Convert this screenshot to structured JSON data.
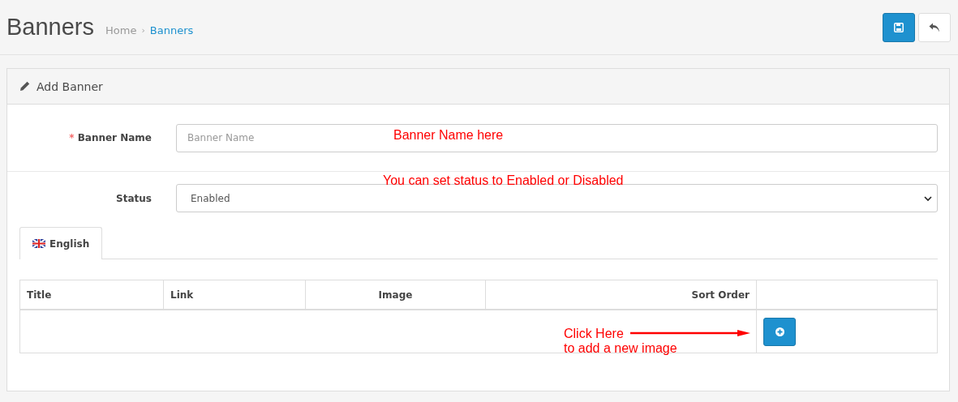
{
  "page_title": "Banners",
  "breadcrumb_separator": "›",
  "breadcrumb": [
    {
      "label": "Home",
      "selected": false
    },
    {
      "label": "Banners",
      "selected": true
    }
  ],
  "panel": {
    "title": "Add Banner"
  },
  "fields": [
    {
      "kind": "text",
      "label": "Banner Name",
      "required_mark": "*",
      "placeholder": "Banner Name",
      "annotation": "Banner Name here"
    },
    {
      "kind": "select",
      "label": "Status",
      "value": "Enabled",
      "annotation": "You can set status to Enabled or Disabled"
    }
  ],
  "tabs": [
    {
      "label": "English",
      "selected": true
    }
  ],
  "table": {
    "columns": [
      "Title",
      "Link",
      "Image",
      "Sort Order"
    ]
  },
  "add_annotation": "Click Here\nto add a new image"
}
